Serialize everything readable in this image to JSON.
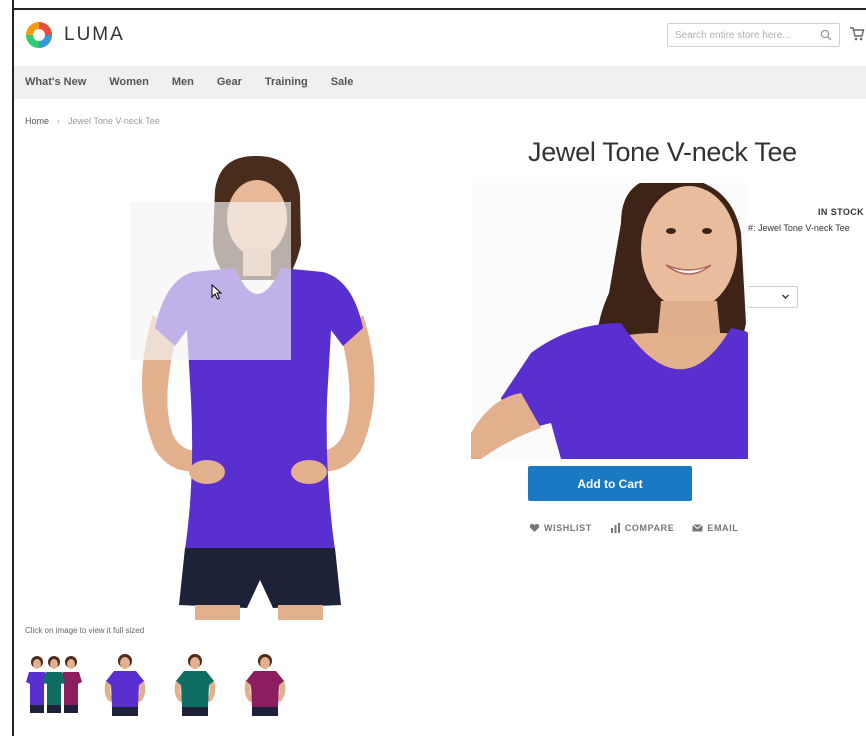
{
  "brand": {
    "name": "LUMA"
  },
  "search": {
    "placeholder": "Search entire store here..."
  },
  "nav": {
    "items": [
      "What's New",
      "Women",
      "Men",
      "Gear",
      "Training",
      "Sale"
    ]
  },
  "breadcrumb": {
    "home": "Home",
    "separator": "›",
    "current": "Jewel Tone V-neck Tee"
  },
  "product": {
    "title": "Jewel Tone V-neck Tee",
    "stock": "IN STOCK",
    "sku": "#:  Jewel Tone V-neck Tee"
  },
  "gallery": {
    "caption": "Click on image to view it full sized"
  },
  "buttons": {
    "add_to_cart": "Add to Cart"
  },
  "actions": {
    "wishlist": "WISHLIST",
    "compare": "COMPARE",
    "email": "EMAIL"
  },
  "colors": {
    "accent": "#1979c3",
    "shirt_purple": "#5a2fd0",
    "shirt_teal": "#0f6e64",
    "shirt_plum": "#8a1e5e",
    "shorts_navy": "#1e2238",
    "navbar": "#f0f0f0"
  },
  "icons": [
    "luma-logo-icon",
    "search-icon",
    "cart-icon",
    "cursor-icon",
    "chevron-down-icon",
    "heart-icon",
    "compare-icon",
    "envelope-icon"
  ],
  "thumbnails": [
    "mixed",
    "purple",
    "teal",
    "plum"
  ]
}
